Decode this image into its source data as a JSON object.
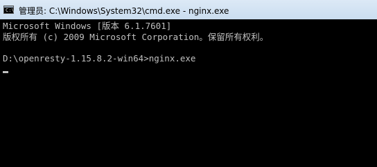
{
  "window": {
    "title": "管理员: C:\\Windows\\System32\\cmd.exe - nginx.exe",
    "icon": "cmd-icon",
    "icon_glyph": "C:\\"
  },
  "console": {
    "lines": [
      "Microsoft Windows [版本 6.1.7601]",
      "版权所有 (c) 2009 Microsoft Corporation。保留所有权利。",
      "",
      "D:\\openresty-1.15.8.2-win64>nginx.exe"
    ]
  },
  "colors": {
    "console_bg": "#000000",
    "console_fg": "#c0c0c0",
    "titlebar": "#dce9f6"
  }
}
